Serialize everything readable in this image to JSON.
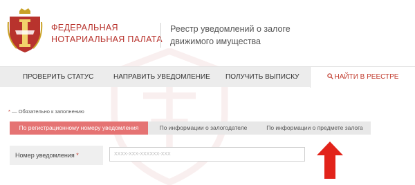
{
  "header": {
    "org_line1": "ФЕДЕРАЛЬНАЯ",
    "org_line2": "НОТАРИАЛЬНАЯ ПАЛАТА",
    "registry_line1": "Реестр уведомлений о залоге",
    "registry_line2": "движимого имущества"
  },
  "nav": {
    "items": [
      {
        "label": "ПРОВЕРИТЬ СТАТУС"
      },
      {
        "label": "НАПРАВИТЬ УВЕДОМЛЕНИЕ"
      },
      {
        "label": "ПОЛУЧИТЬ ВЫПИСКУ"
      },
      {
        "label": "НАЙТИ В РЕЕСТРЕ",
        "icon": "search-icon",
        "active": true
      }
    ]
  },
  "required_note": {
    "star": "*",
    "text": " — Обязательно к заполнению"
  },
  "tabs": [
    {
      "label": "По регистрационному номеру уведомления",
      "active": true
    },
    {
      "label": "По информации о залогодателе"
    },
    {
      "label": "По информации о предмете залога"
    }
  ],
  "form": {
    "field_label": "Номер уведомления",
    "field_star": "*",
    "field_placeholder": "XXXX-XXX-XXXXXX-XXX",
    "field_value": ""
  },
  "colors": {
    "brand_red": "#b8332d",
    "tab_active": "#e57373",
    "arrow_red": "#e2231a"
  }
}
